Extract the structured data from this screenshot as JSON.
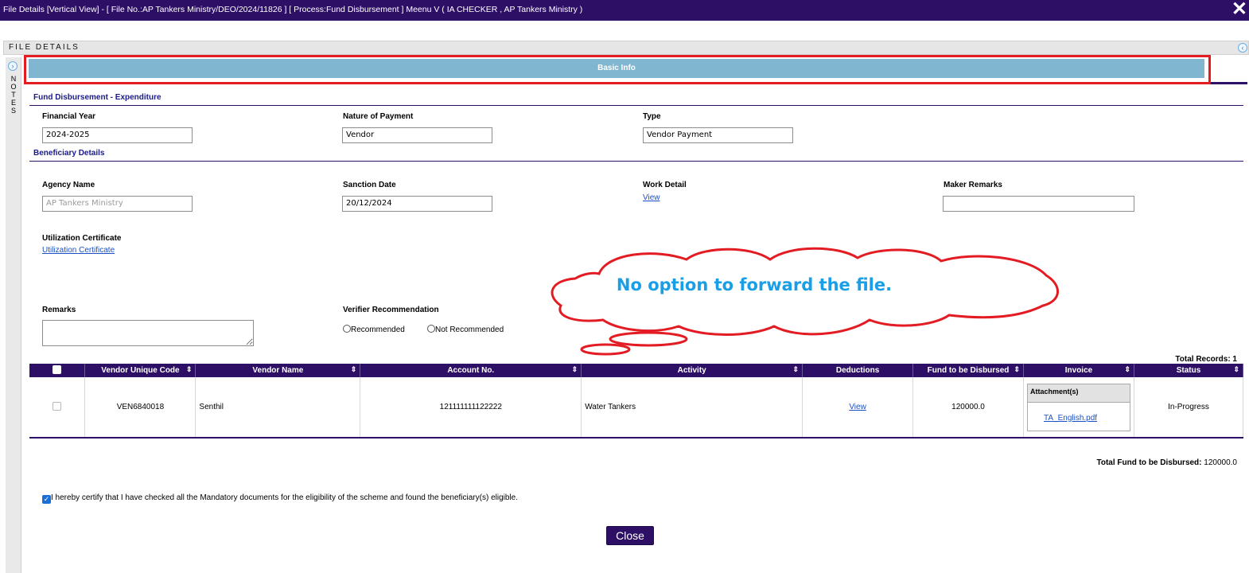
{
  "titlebar": {
    "title": "File Details [Vertical View] - [ File No.:AP Tankers Ministry/DEO/2024/11826 ] [ Process:Fund Disbursement ] Meenu V ( IA CHECKER , AP Tankers Ministry )",
    "close_glyph": "✕"
  },
  "file_details": {
    "label": "FILE DETAILS",
    "toggle_glyph": "‹"
  },
  "notes": {
    "label": "NOTES",
    "toggle_glyph": "›"
  },
  "tabs": {
    "basic_info": "Basic Info"
  },
  "fund_section": {
    "title": "Fund Disbursement - Expenditure",
    "financial_year_label": "Financial Year",
    "financial_year_value": "2024-2025",
    "nature_label": "Nature of Payment",
    "nature_value": "Vendor",
    "type_label": "Type",
    "type_value": "Vendor Payment"
  },
  "beneficiary_section": {
    "title": "Beneficiary Details",
    "agency_label": "Agency Name",
    "agency_placeholder": "AP Tankers Ministry",
    "sanction_label": "Sanction Date",
    "sanction_value": "20/12/2024",
    "work_label": "Work Detail",
    "work_link": "View",
    "maker_label": "Maker Remarks",
    "maker_value": "",
    "uc_label": "Utilization Certificate",
    "uc_link": "Utilization Certificate",
    "remarks_label": "Remarks",
    "verifier_label": "Verifier Recommendation",
    "radio_recommended": "Recommended",
    "radio_not_recommended": "Not Recommended"
  },
  "annotation": {
    "text": "No option to forward the file.",
    "color": "#1a9ee6",
    "outline_color": "#e31b23"
  },
  "grid": {
    "total_records": "Total Records: 1",
    "columns": [
      "Vendor Unique Code",
      "Vendor Name",
      "Account No.",
      "Activity",
      "Deductions",
      "Fund to be Disbursed",
      "Invoice",
      "Status"
    ],
    "rows": [
      {
        "code": "VEN6840018",
        "name": "Senthil",
        "account": "121111111122222",
        "activity": "Water Tankers",
        "deductions": "View",
        "fund": "120000.0",
        "attachment_header": "Attachment(s)",
        "attachment_file": "TA_English.pdf",
        "status": "In-Progress"
      }
    ]
  },
  "total_fund": {
    "label": "Total Fund to be Disbursed:",
    "value": "120000.0"
  },
  "certify_text": "I hereby certify that I have checked all the Mandatory documents for the eligibility of the scheme and found the beneficiary(s) eligible.",
  "close_button": "Close",
  "colors": {
    "primary": "#2e0f66",
    "tab": "#80b6cf",
    "highlight": "#e31b23",
    "link": "#1a4fc7"
  }
}
